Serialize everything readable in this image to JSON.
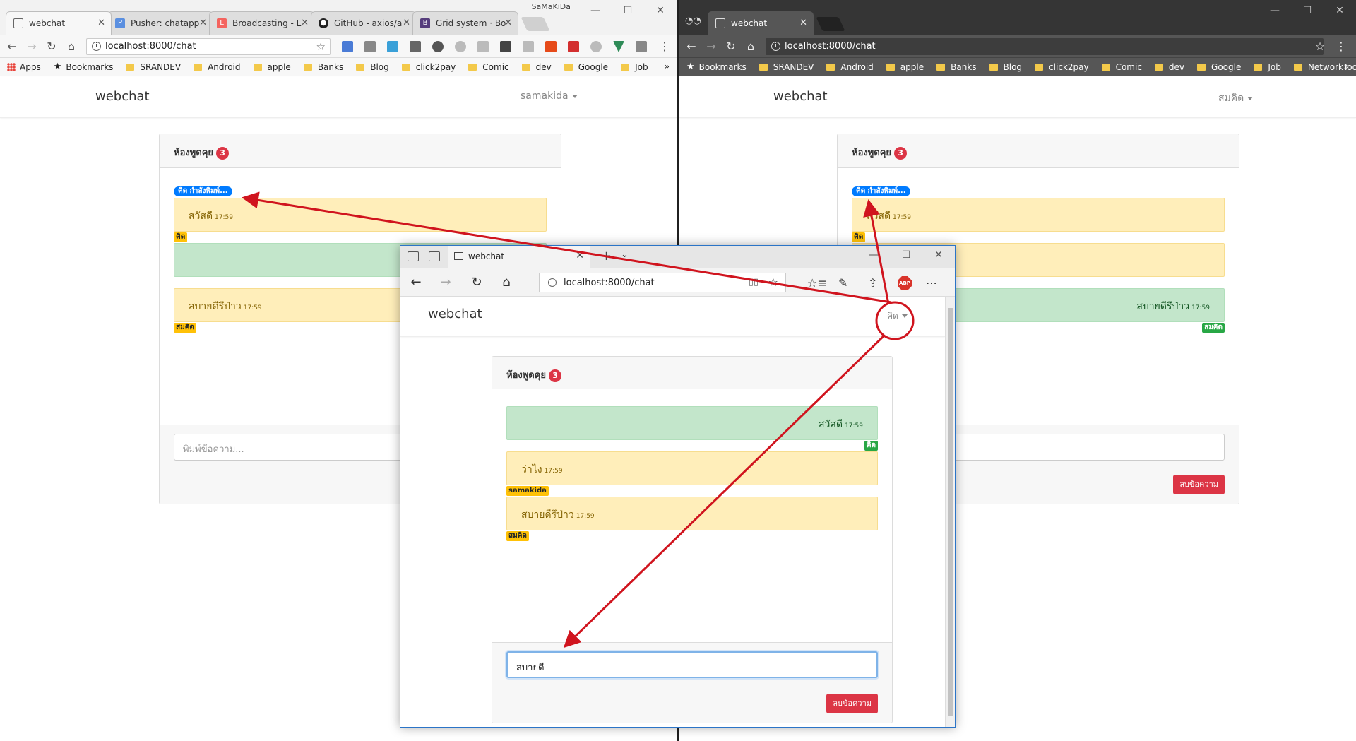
{
  "left_window": {
    "title_user": "SaMaKiDa",
    "tabs": [
      {
        "label": "webchat",
        "active": true,
        "icon": "page-icon"
      },
      {
        "label": "Pusher: chatapp",
        "icon": "pusher-icon"
      },
      {
        "label": "Broadcasting - L",
        "icon": "laravel-icon"
      },
      {
        "label": "GitHub - axios/a",
        "icon": "github-icon"
      },
      {
        "label": "Grid system · Bo",
        "icon": "bootstrap-icon"
      }
    ],
    "url": "localhost:8000/chat",
    "bookmarks": [
      "Apps",
      "Bookmarks",
      "SRANDEV",
      "Android",
      "apple",
      "Banks",
      "Blog",
      "click2pay",
      "Comic",
      "dev",
      "Google",
      "Job"
    ],
    "more": "»",
    "app": {
      "brand": "webchat",
      "user": "samakida",
      "room_title": "ห้องพูดคุย",
      "room_count": "3",
      "typing": "คิด กำลังพิมพ์...",
      "messages": [
        {
          "text": "สวัสดี",
          "time": "17:59",
          "author": "คิด",
          "style": "yellow"
        },
        {
          "text": "",
          "time": "",
          "author": "",
          "style": "green"
        },
        {
          "text": "สบายดีรึป่าว",
          "time": "17:59",
          "author": "สมคิด",
          "style": "yellow"
        }
      ],
      "input_placeholder": "พิมพ์ข้อความ..."
    }
  },
  "right_window": {
    "tabs": [
      {
        "label": "webchat",
        "active": true
      }
    ],
    "url": "localhost:8000/chat",
    "bookmarks": [
      "Bookmarks",
      "SRANDEV",
      "Android",
      "apple",
      "Banks",
      "Blog",
      "click2pay",
      "Comic",
      "dev",
      "Google",
      "Job",
      "NetworkTools"
    ],
    "more": "»",
    "app": {
      "brand": "webchat",
      "user": "สมคิด",
      "room_title": "ห้องพูดคุย",
      "room_count": "3",
      "typing": "คิด กำลังพิมพ์...",
      "messages": [
        {
          "text": "สวัสดี",
          "time": "17:59",
          "author": "คิด",
          "style": "yellow"
        },
        {
          "text": "",
          "time": "",
          "author": "",
          "style": "yellow"
        },
        {
          "text": "สบายดีรึป่าว",
          "time": "17:59",
          "author": "สมคิด",
          "style": "green"
        }
      ],
      "clear_button": "ลบข้อความ"
    }
  },
  "edge_window": {
    "tab_label": "webchat",
    "url": "localhost:8000/chat",
    "abp_label": "ABP",
    "app": {
      "brand": "webchat",
      "user": "คิด",
      "room_title": "ห้องพูดคุย",
      "room_count": "3",
      "messages": [
        {
          "text": "สวัสดี",
          "time": "17:59",
          "author": "คิด",
          "style": "green"
        },
        {
          "text": "ว่าไง",
          "time": "17:59",
          "author": "samakida",
          "style": "yellow"
        },
        {
          "text": "สบายดีรึป่าว",
          "time": "17:59",
          "author": "สมคิด",
          "style": "yellow"
        }
      ],
      "input_value": "สบายดี",
      "clear_button": "ลบข้อความ"
    }
  },
  "colors": {
    "annotation": "#d0141e",
    "danger": "#dc3545",
    "warning": "#ffc107",
    "success": "#28a745",
    "primary": "#007bff"
  }
}
